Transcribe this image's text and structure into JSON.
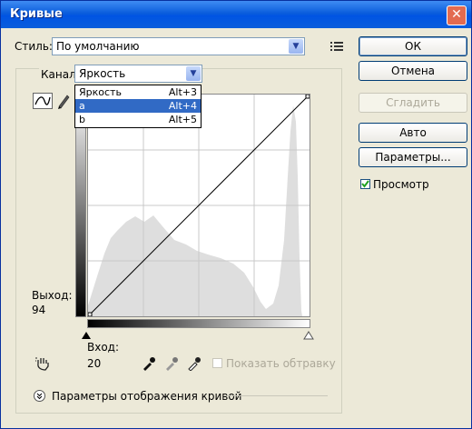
{
  "window": {
    "title": "Кривые",
    "close_glyph": "✕"
  },
  "preset": {
    "label": "Стиль:",
    "value": "По умолчанию"
  },
  "buttons": {
    "ok": "ОК",
    "cancel": "Отмена",
    "smooth": "Сгладить",
    "auto": "Авто",
    "options": "Параметры..."
  },
  "preview": {
    "label": "Просмотр",
    "checked": true
  },
  "channel": {
    "label": "Канал:",
    "value": "Яркость",
    "options": [
      {
        "label": "Яркость",
        "shortcut": "Alt+3"
      },
      {
        "label": "a",
        "shortcut": "Alt+4",
        "selected": true
      },
      {
        "label": "b",
        "shortcut": "Alt+5"
      }
    ]
  },
  "output": {
    "label": "Выход:",
    "value": "94"
  },
  "input": {
    "label": "Вход:",
    "value": "20"
  },
  "clipping": {
    "label": "Показать обтравку",
    "checked": false
  },
  "display_options": {
    "label": "Параметры отображения кривой"
  }
}
